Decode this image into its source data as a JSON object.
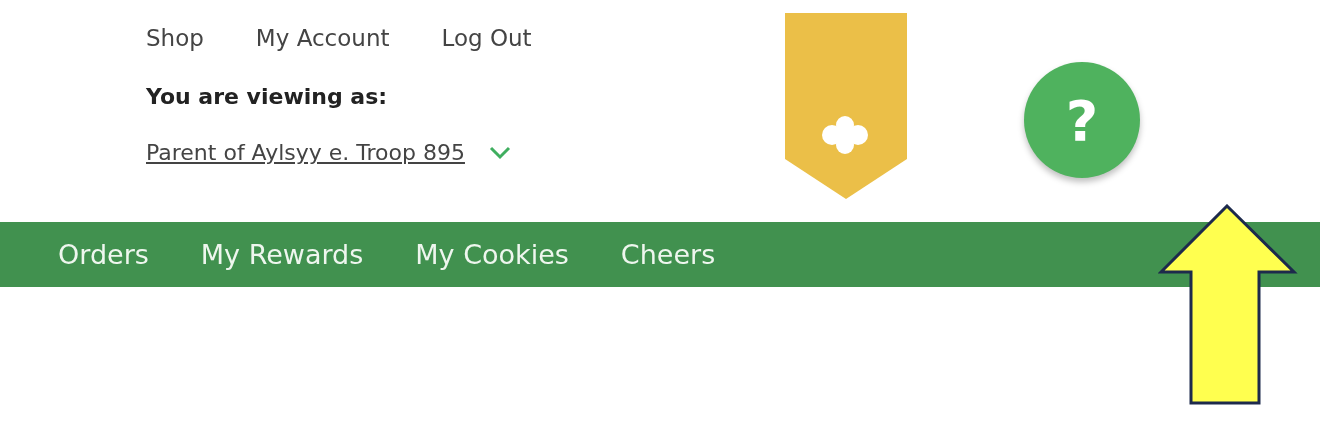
{
  "top_links": [
    "Shop",
    "My Account",
    "Log Out"
  ],
  "viewing_label": "You are viewing as:",
  "viewing_as": {
    "value": "Parent of Aylsyy e. Troop 895"
  },
  "help_button": {
    "label": "?"
  },
  "nav": [
    "Orders",
    "My Rewards",
    "My Cookies",
    "Cheers"
  ]
}
